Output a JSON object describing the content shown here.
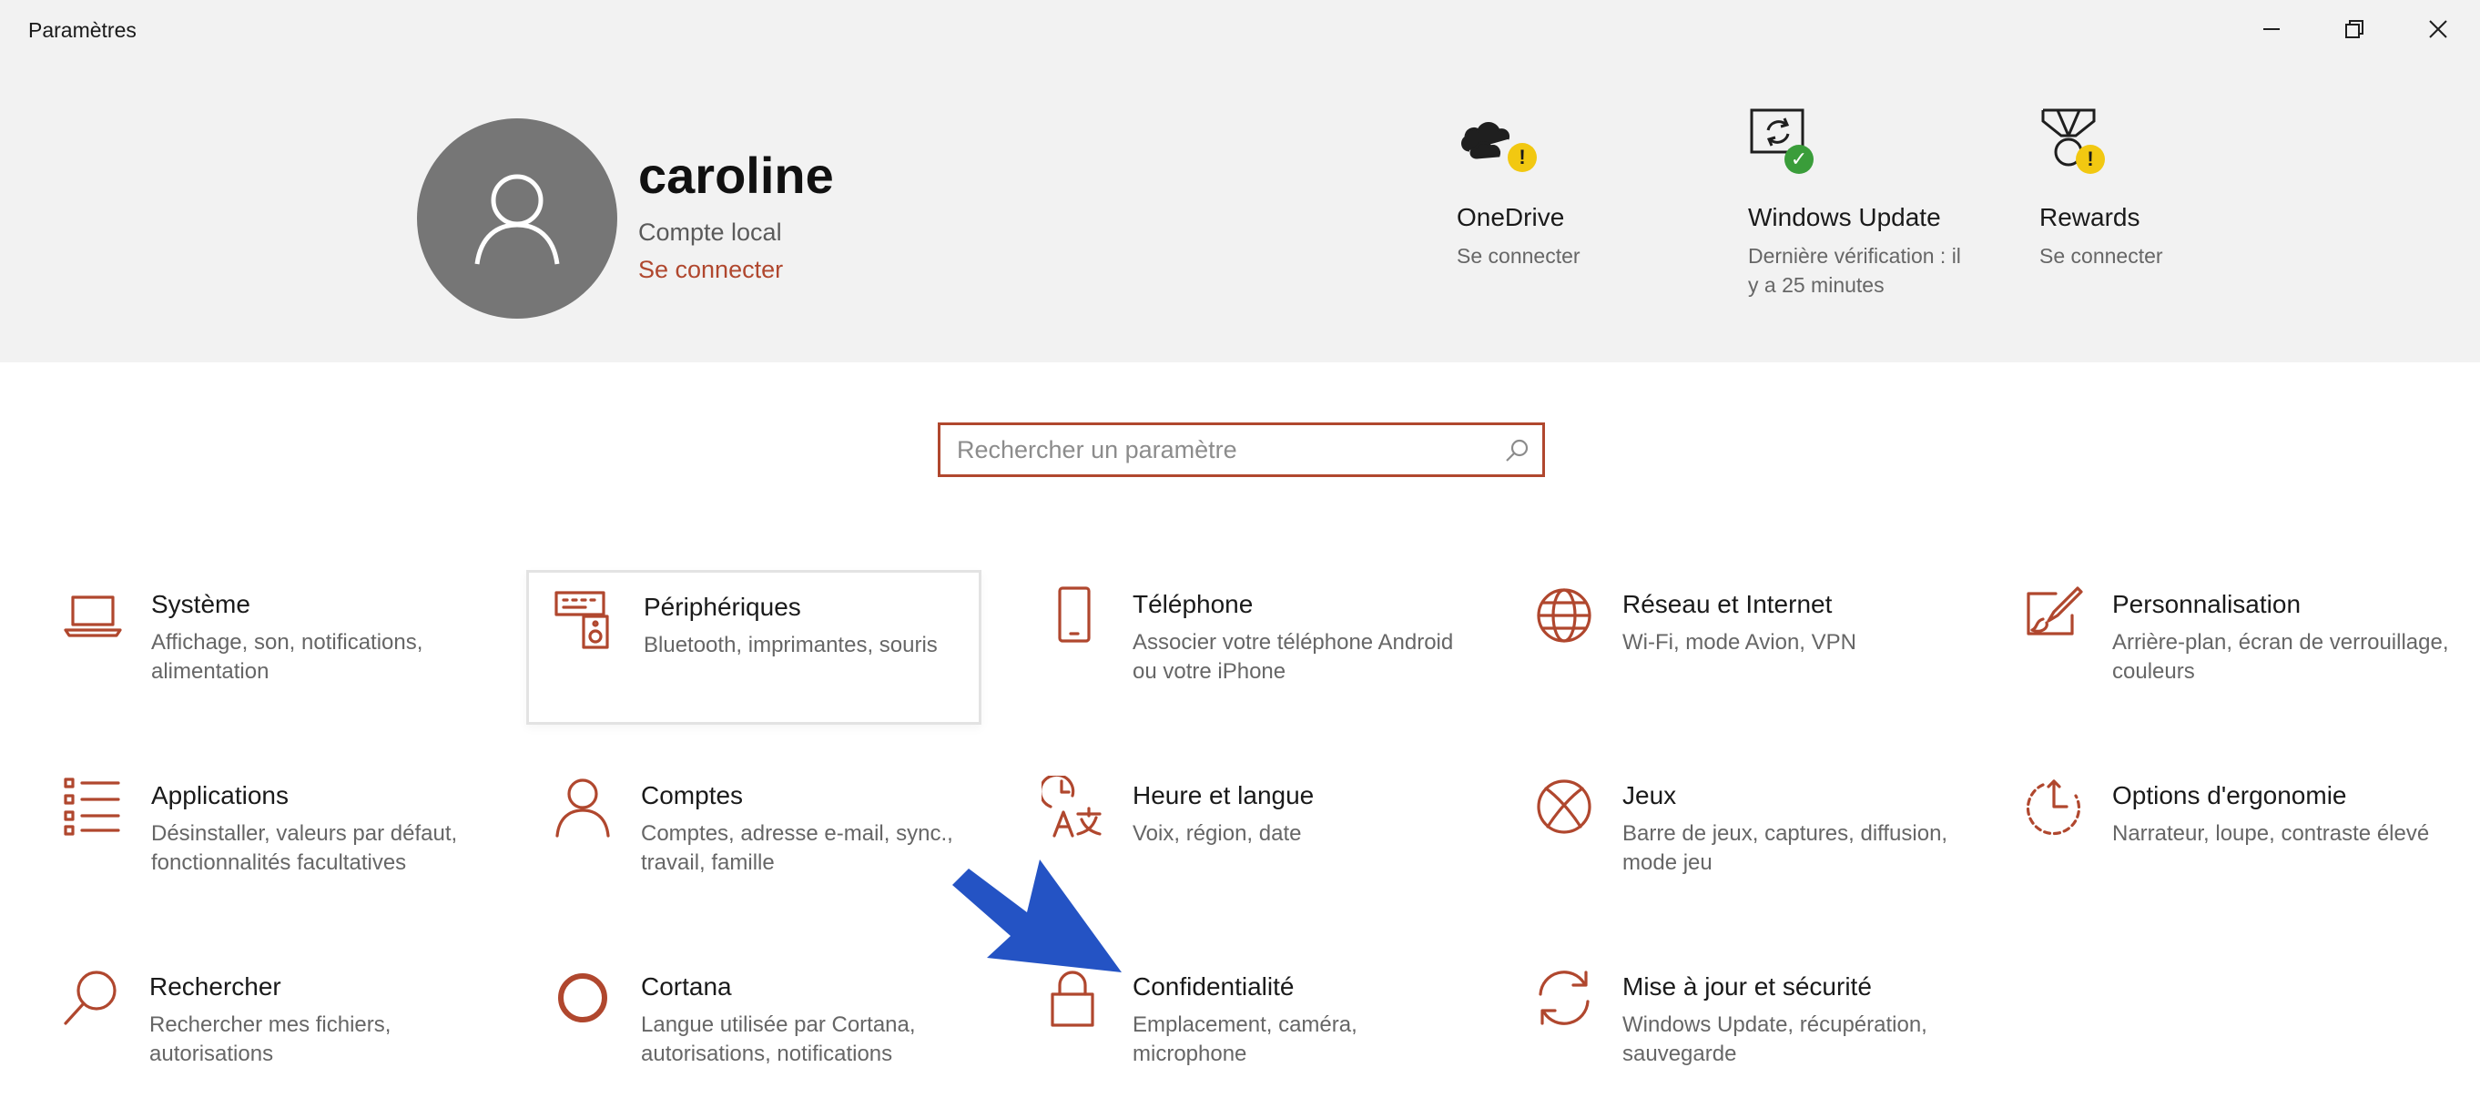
{
  "window": {
    "title": "Paramètres"
  },
  "account": {
    "name": "caroline",
    "type": "Compte local",
    "signin_link": "Se connecter"
  },
  "services": [
    {
      "title": "OneDrive",
      "subtitle": "Se connecter",
      "icon": "onedrive-cloud-icon",
      "status": "warning"
    },
    {
      "title": "Windows Update",
      "subtitle": "Dernière vérification : il y a 25 minutes",
      "icon": "windows-update-icon",
      "status": "ok"
    },
    {
      "title": "Rewards",
      "subtitle": "Se connecter",
      "icon": "rewards-medal-icon",
      "status": "warning"
    }
  ],
  "search": {
    "placeholder": "Rechercher un paramètre",
    "value": ""
  },
  "categories": [
    {
      "title": "Système",
      "description": "Affichage, son, notifications, alimentation",
      "icon": "laptop-icon"
    },
    {
      "title": "Périphériques",
      "description": "Bluetooth, imprimantes, souris",
      "icon": "devices-icon"
    },
    {
      "title": "Téléphone",
      "description": "Associer votre téléphone Android ou votre iPhone",
      "icon": "phone-icon"
    },
    {
      "title": "Réseau et Internet",
      "description": "Wi-Fi, mode Avion, VPN",
      "icon": "globe-icon"
    },
    {
      "title": "Personnalisation",
      "description": "Arrière-plan, écran de verrouillage, couleurs",
      "icon": "paint-icon"
    },
    {
      "title": "Applications",
      "description": "Désinstaller, valeurs par défaut, fonctionnalités facultatives",
      "icon": "apps-list-icon"
    },
    {
      "title": "Comptes",
      "description": "Comptes, adresse e-mail, sync., travail, famille",
      "icon": "person-icon"
    },
    {
      "title": "Heure et langue",
      "description": "Voix, région, date",
      "icon": "time-language-icon"
    },
    {
      "title": "Jeux",
      "description": "Barre de jeux, captures, diffusion, mode jeu",
      "icon": "xbox-icon"
    },
    {
      "title": "Options d'ergonomie",
      "description": "Narrateur, loupe, contraste élevé",
      "icon": "ease-of-access-icon"
    },
    {
      "title": "Rechercher",
      "description": "Rechercher mes fichiers, autorisations",
      "icon": "magnifier-icon"
    },
    {
      "title": "Cortana",
      "description": "Langue utilisée par Cortana, autorisations, notifications",
      "icon": "cortana-icon"
    },
    {
      "title": "Confidentialité",
      "description": "Emplacement, caméra, microphone",
      "icon": "lock-icon"
    },
    {
      "title": "Mise à jour et sécurité",
      "description": "Windows Update, récupération, sauvegarde",
      "icon": "sync-icon"
    }
  ],
  "colors": {
    "accent": "#b0472e",
    "header_bg": "#f2f2f2",
    "annotation_arrow": "#2453c4"
  }
}
